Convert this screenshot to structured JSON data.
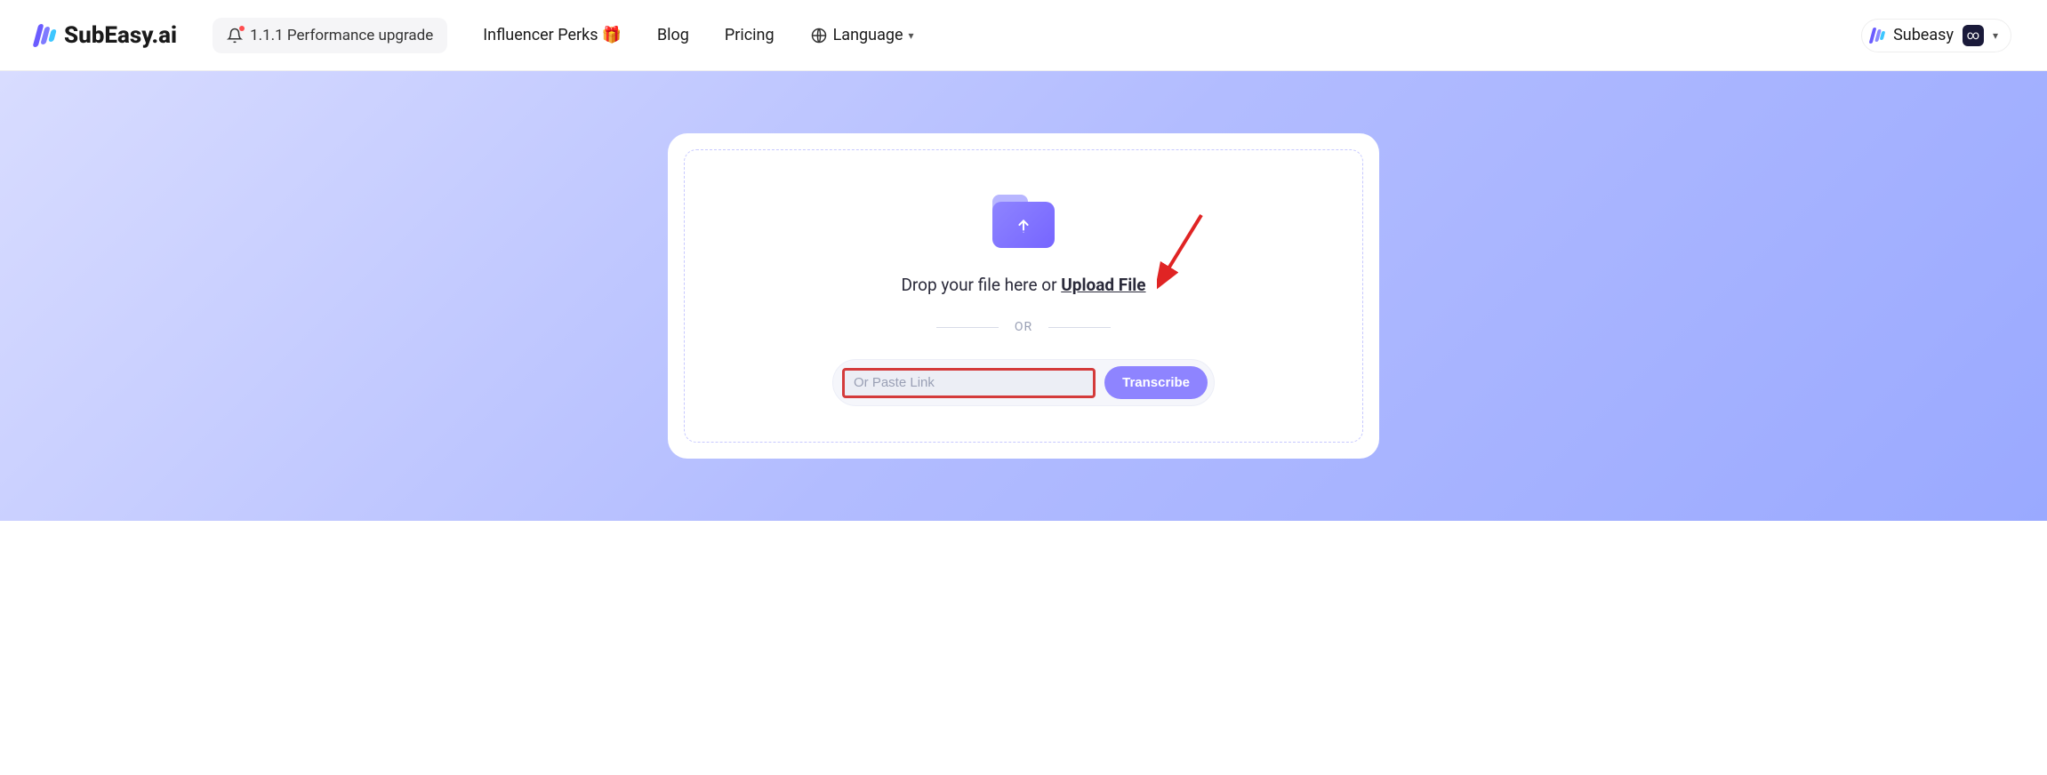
{
  "header": {
    "brand": "SubEasy.ai",
    "announcement": "1.1.1 Performance upgrade",
    "nav": {
      "influencer": "Influencer Perks",
      "gift_emoji": "🎁",
      "blog": "Blog",
      "pricing": "Pricing",
      "language": "Language"
    },
    "user": {
      "name": "Subeasy",
      "badge": "∞"
    }
  },
  "upload": {
    "drop_prefix": "Drop your file here or ",
    "upload_link": "Upload File",
    "or": "OR",
    "input_placeholder": "Or Paste Link",
    "transcribe": "Transcribe"
  }
}
